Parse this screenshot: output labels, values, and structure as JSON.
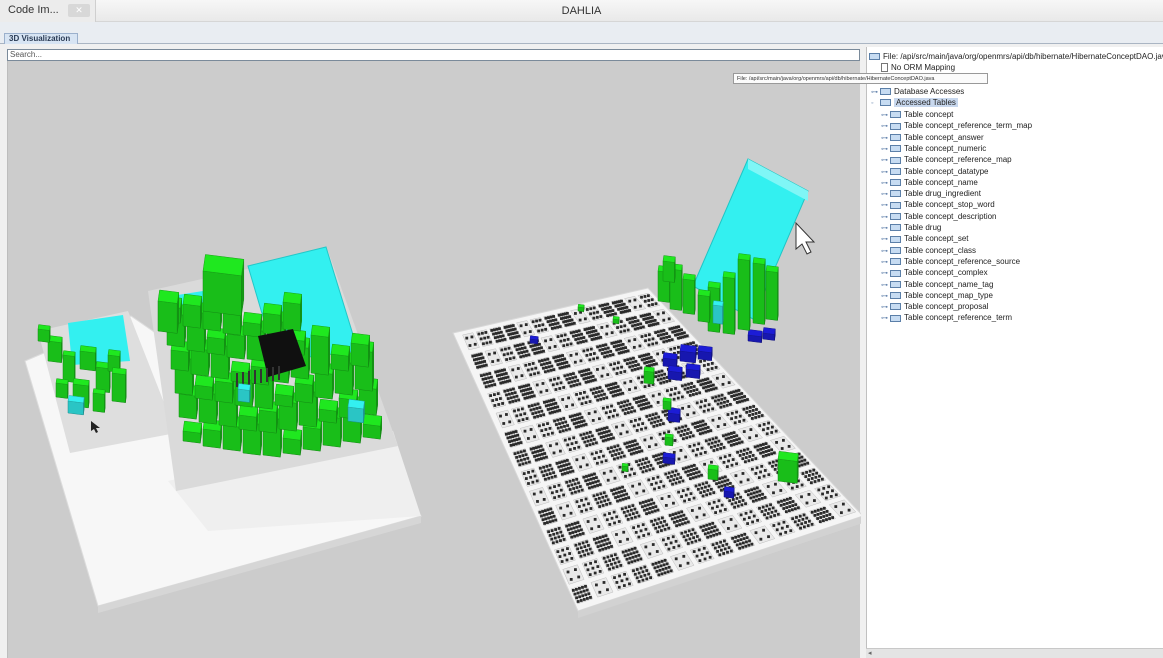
{
  "window": {
    "title": "DAHLIA"
  },
  "app_tab": {
    "label": "Code Im...",
    "close": "✕"
  },
  "tabs": [
    {
      "label": "3D Visualization"
    }
  ],
  "search": {
    "placeholder": "Search..."
  },
  "tooltip": {
    "text": "File: /api/src/main/java/org/openmrs/api/db/hibernate/HibernateConceptDAO.java"
  },
  "tree": {
    "file": "File: /api/src/main/java/org/openmrs/api/db/hibernate/HibernateConceptDAO.java",
    "no_orm": "No ORM Mapping",
    "database_accesses": "Database Accesses",
    "accessed_tables": "Accessed Tables",
    "tables": [
      "Table concept",
      "Table concept_reference_term_map",
      "Table concept_answer",
      "Table concept_numeric",
      "Table concept_reference_map",
      "Table concept_datatype",
      "Table concept_name",
      "Table drug_ingredient",
      "Table concept_stop_word",
      "Table concept_description",
      "Table drug",
      "Table concept_set",
      "Table concept_class",
      "Table concept_reference_source",
      "Table concept_complex",
      "Table concept_name_tag",
      "Table concept_map_type",
      "Table concept_proposal",
      "Table concept_reference_term"
    ]
  },
  "colors": {
    "accessed": "#1fe81f",
    "selected": "#33f0f0",
    "highlight": "#1c1cd6",
    "dark": "#101010",
    "platform": "#f5f5f5",
    "viewport": "#cccccc"
  }
}
